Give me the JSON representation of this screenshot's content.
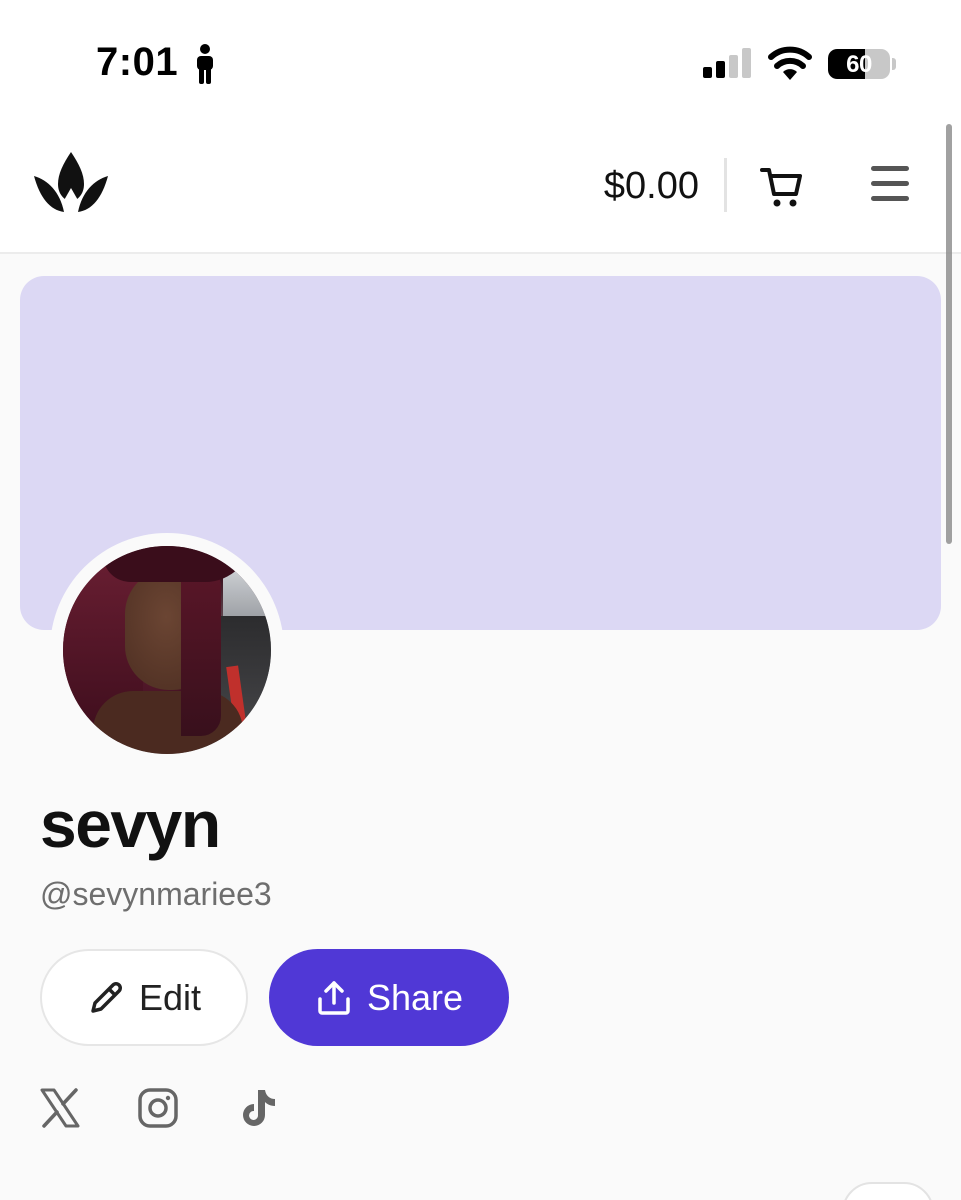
{
  "status_bar": {
    "time": "7:01",
    "battery_percent": "60",
    "battery_level": 0.6
  },
  "header": {
    "logo_icon": "crown-logo-icon",
    "balance": "$0.00",
    "cart_icon": "cart-icon",
    "menu_icon": "hamburger-menu-icon"
  },
  "profile": {
    "banner_color": "#dcd8f4",
    "name": "sevyn",
    "handle": "@sevynmariee3",
    "edit_label": "Edit",
    "share_label": "Share",
    "accent_color": "#5038d6"
  },
  "socials": [
    {
      "icon": "x-twitter-icon"
    },
    {
      "icon": "instagram-icon"
    },
    {
      "icon": "tiktok-icon"
    }
  ]
}
